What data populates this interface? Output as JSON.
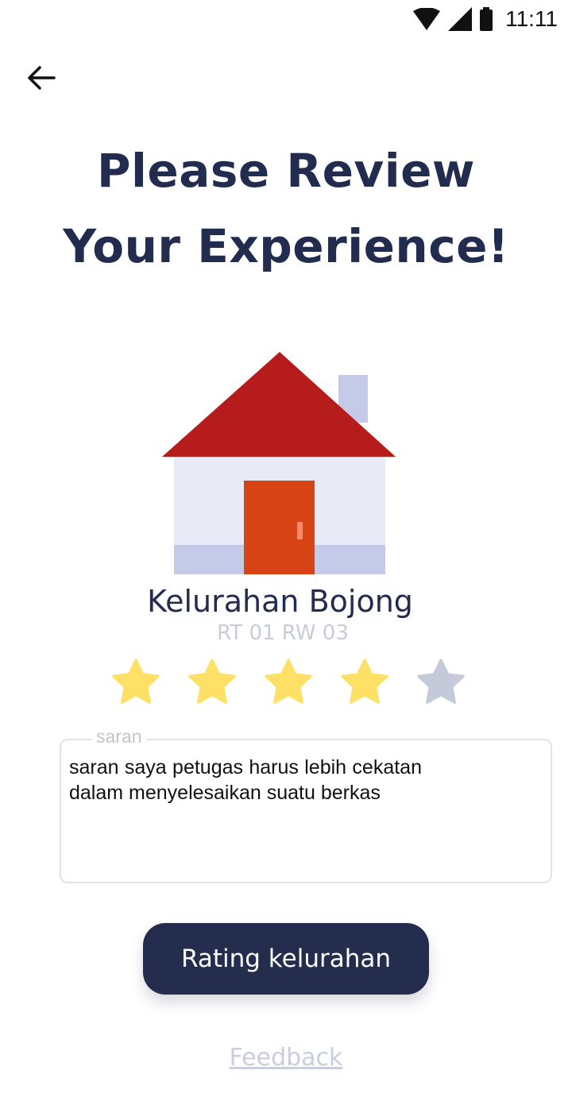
{
  "status_bar": {
    "time": "11:11",
    "icons": [
      "wifi-icon",
      "signal-icon",
      "battery-icon"
    ]
  },
  "nav": {
    "back_icon": "arrow-left-icon"
  },
  "title": {
    "line1": "Please Review",
    "line2": "Your Experience!"
  },
  "place": {
    "name": "Kelurahan Bojong",
    "subtitle": "RT 01 RW 03",
    "image_icon": "house-icon"
  },
  "rating": {
    "value": 4,
    "max": 5,
    "filled_color": "#ffe066",
    "empty_color": "#c5cadb"
  },
  "feedback": {
    "label": "saran",
    "value": "saran saya petugas harus lebih cekatan dalam menyelesaikan suatu berkas"
  },
  "submit_button": {
    "label": "Rating kelurahan"
  },
  "feedback_link": {
    "label": "Feedback"
  },
  "colors": {
    "primary": "#252d4f",
    "roof": "#b71c1c",
    "door": "#d84315",
    "wall": "#e8eaf6",
    "wall_accent": "#c5cae9"
  }
}
